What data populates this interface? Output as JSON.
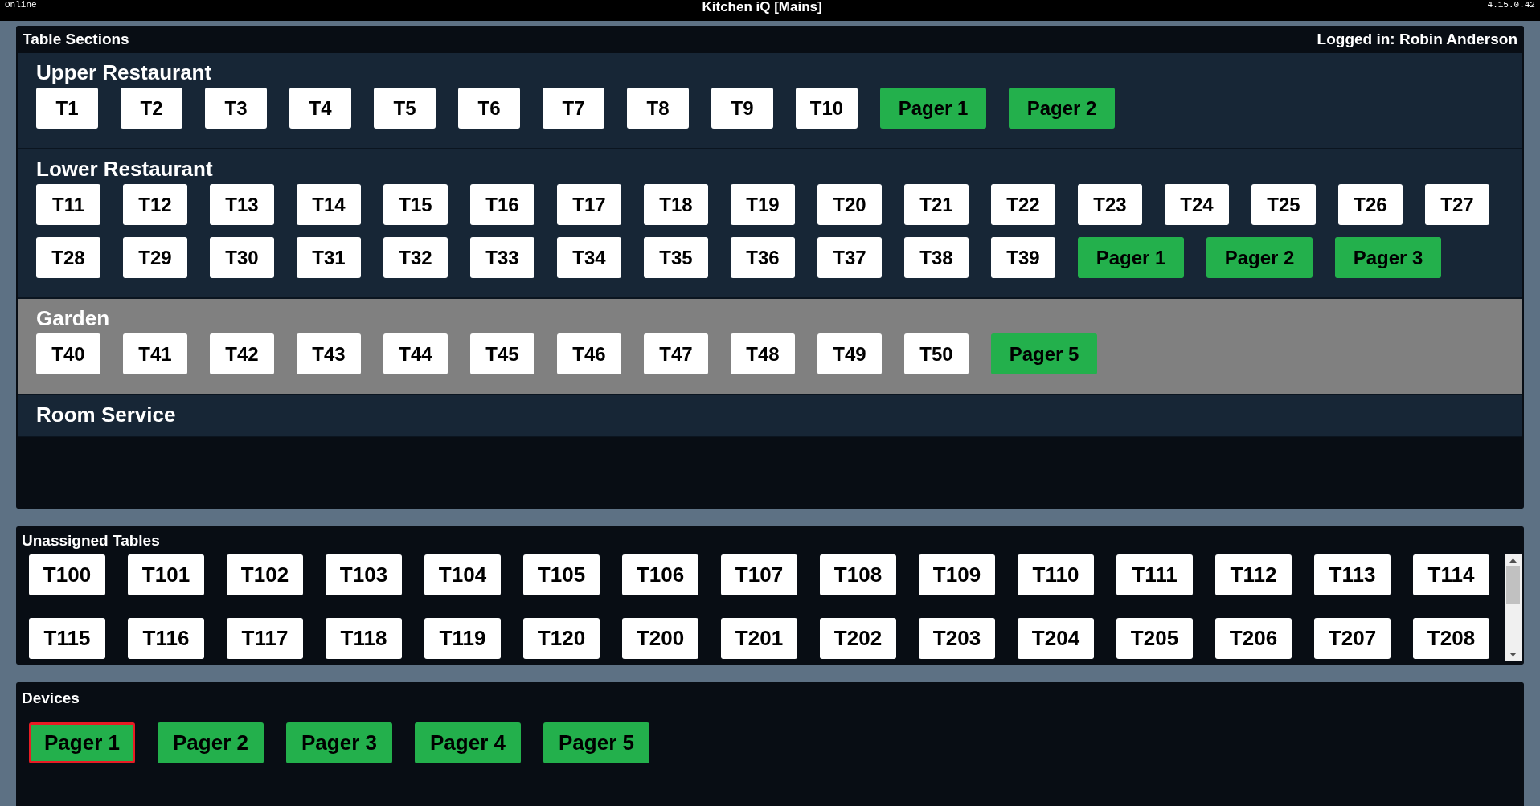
{
  "top_bar": {
    "status": "Online",
    "title": "Kitchen iQ [Mains]",
    "version": "4.15.0.42"
  },
  "table_sections": {
    "title": "Table Sections",
    "logged_in": "Logged in: Robin Anderson",
    "sections": [
      {
        "name": "Upper Restaurant",
        "selected": false,
        "items": [
          {
            "label": "T1",
            "kind": "table"
          },
          {
            "label": "T2",
            "kind": "table"
          },
          {
            "label": "T3",
            "kind": "table"
          },
          {
            "label": "T4",
            "kind": "table"
          },
          {
            "label": "T5",
            "kind": "table"
          },
          {
            "label": "T6",
            "kind": "table"
          },
          {
            "label": "T7",
            "kind": "table"
          },
          {
            "label": "T8",
            "kind": "table"
          },
          {
            "label": "T9",
            "kind": "table"
          },
          {
            "label": "T10",
            "kind": "table"
          },
          {
            "label": "Pager 1",
            "kind": "pager"
          },
          {
            "label": "Pager 2",
            "kind": "pager"
          }
        ]
      },
      {
        "name": "Lower Restaurant",
        "selected": false,
        "items": [
          {
            "label": "T11",
            "kind": "table"
          },
          {
            "label": "T12",
            "kind": "table"
          },
          {
            "label": "T13",
            "kind": "table"
          },
          {
            "label": "T14",
            "kind": "table"
          },
          {
            "label": "T15",
            "kind": "table"
          },
          {
            "label": "T16",
            "kind": "table"
          },
          {
            "label": "T17",
            "kind": "table"
          },
          {
            "label": "T18",
            "kind": "table"
          },
          {
            "label": "T19",
            "kind": "table"
          },
          {
            "label": "T20",
            "kind": "table"
          },
          {
            "label": "T21",
            "kind": "table"
          },
          {
            "label": "T22",
            "kind": "table"
          },
          {
            "label": "T23",
            "kind": "table"
          },
          {
            "label": "T24",
            "kind": "table"
          },
          {
            "label": "T25",
            "kind": "table"
          },
          {
            "label": "T26",
            "kind": "table"
          },
          {
            "label": "T27",
            "kind": "table"
          },
          {
            "label": "T28",
            "kind": "table"
          },
          {
            "label": "T29",
            "kind": "table"
          },
          {
            "label": "T30",
            "kind": "table"
          },
          {
            "label": "T31",
            "kind": "table"
          },
          {
            "label": "T32",
            "kind": "table"
          },
          {
            "label": "T33",
            "kind": "table"
          },
          {
            "label": "T34",
            "kind": "table"
          },
          {
            "label": "T35",
            "kind": "table"
          },
          {
            "label": "T36",
            "kind": "table"
          },
          {
            "label": "T37",
            "kind": "table"
          },
          {
            "label": "T38",
            "kind": "table"
          },
          {
            "label": "T39",
            "kind": "table"
          },
          {
            "label": "Pager 1",
            "kind": "pager"
          },
          {
            "label": "Pager 2",
            "kind": "pager"
          },
          {
            "label": "Pager 3",
            "kind": "pager"
          }
        ]
      },
      {
        "name": "Garden",
        "selected": true,
        "items": [
          {
            "label": "T40",
            "kind": "table"
          },
          {
            "label": "T41",
            "kind": "table"
          },
          {
            "label": "T42",
            "kind": "table"
          },
          {
            "label": "T43",
            "kind": "table"
          },
          {
            "label": "T44",
            "kind": "table"
          },
          {
            "label": "T45",
            "kind": "table"
          },
          {
            "label": "T46",
            "kind": "table"
          },
          {
            "label": "T47",
            "kind": "table"
          },
          {
            "label": "T48",
            "kind": "table"
          },
          {
            "label": "T49",
            "kind": "table"
          },
          {
            "label": "T50",
            "kind": "table"
          },
          {
            "label": "Pager 5",
            "kind": "pager"
          }
        ]
      },
      {
        "name": "Room Service",
        "selected": false
      }
    ]
  },
  "unassigned_tables": {
    "title": "Unassigned Tables",
    "tables": [
      "T100",
      "T101",
      "T102",
      "T103",
      "T104",
      "T105",
      "T106",
      "T107",
      "T108",
      "T109",
      "T110",
      "T111",
      "T112",
      "T113",
      "T114",
      "T115",
      "T116",
      "T117",
      "T118",
      "T119",
      "T120",
      "T200",
      "T201",
      "T202",
      "T203",
      "T204",
      "T205",
      "T206",
      "T207",
      "T208"
    ]
  },
  "devices": {
    "title": "Devices",
    "items": [
      {
        "label": "Pager 1",
        "selected": true
      },
      {
        "label": "Pager 2",
        "selected": false
      },
      {
        "label": "Pager 3",
        "selected": false
      },
      {
        "label": "Pager 4",
        "selected": false
      },
      {
        "label": "Pager 5",
        "selected": false
      }
    ]
  }
}
